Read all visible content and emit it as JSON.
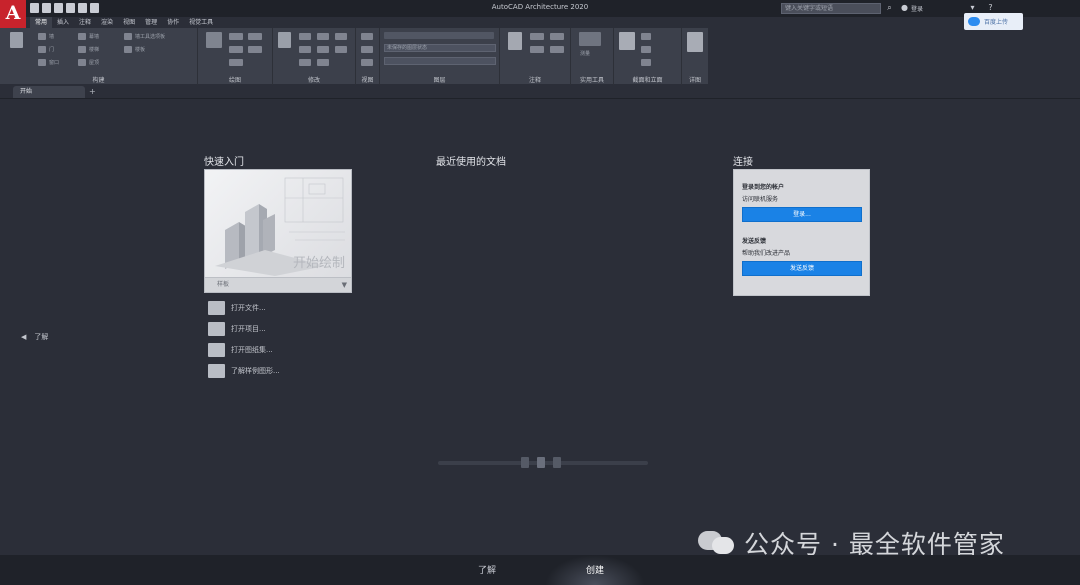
{
  "window": {
    "app_letter": "A",
    "title": "AutoCAD Architecture 2020",
    "search_placeholder": "键入关键字或短语",
    "login": "登录",
    "cloud_button": "百度上传"
  },
  "ribbon": {
    "tabs": [
      "常用",
      "插入",
      "注释",
      "渲染",
      "视图",
      "管理",
      "协作",
      "视觉工具"
    ],
    "active_tab": "常用",
    "panels": [
      "构建",
      "绘图",
      "修改",
      "视图",
      "图层",
      "注释",
      "实用工具",
      "截面和立面",
      "详图"
    ],
    "combo_layer": "未保存的图层状态",
    "tool_labels": {
      "wall": "墙",
      "door": "门",
      "window": "窗口",
      "stair": "楼梯",
      "roof": "屋顶",
      "floor": "楼板",
      "curtain_wall": "幕墙",
      "wall_tool_palette": "墙工具选项板",
      "measure": "测量"
    }
  },
  "doc_tabs": {
    "start_tab": "开始",
    "plus": "+"
  },
  "start": {
    "quick_start_heading": "快速入门",
    "recent_docs_heading": "最近使用的文档",
    "connect_heading": "连接",
    "thumb_caption": "开始绘制",
    "template_label": "样板",
    "quick_links": [
      "打开文件...",
      "打开项目...",
      "打开图纸集...",
      "了解样例图形..."
    ],
    "left_nav": "了解",
    "connect": {
      "signin_title": "登录到您的帐户",
      "signin_sub": "访问联机服务",
      "signin_button": "登录...",
      "feedback_title": "发送反馈",
      "feedback_sub": "帮助我们改进产品",
      "feedback_button": "发送反馈"
    }
  },
  "bottom_tabs": [
    "了解",
    "创建"
  ],
  "active_bottom_tab": "创建",
  "watermark": "公众号 · 最全软件管家"
}
